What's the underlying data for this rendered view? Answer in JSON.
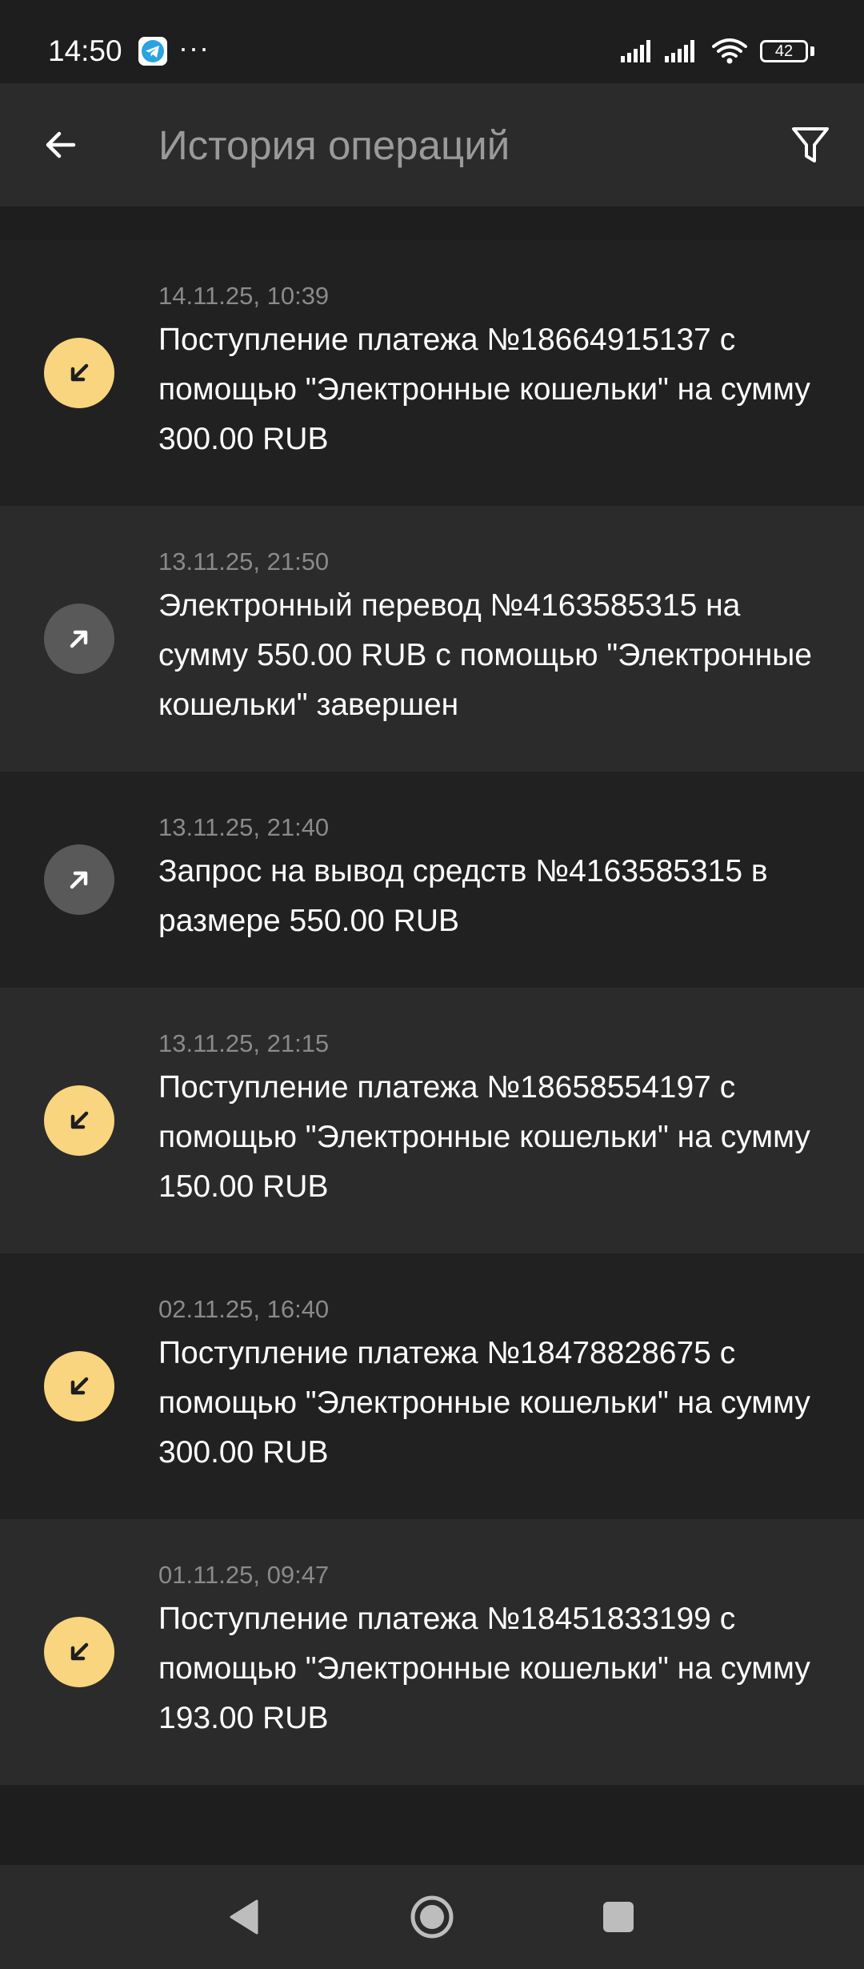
{
  "status_bar": {
    "time": "14:50",
    "dots": "···",
    "battery": "42",
    "icons": [
      "telegram-icon",
      "signal-icon",
      "signal-icon",
      "wifi-icon",
      "battery-icon"
    ]
  },
  "app_bar": {
    "title": "История операций",
    "back_icon": "arrow-left-icon",
    "filter_icon": "filter-icon"
  },
  "transactions": [
    {
      "direction": "in",
      "icon": "arrow-down-left-icon",
      "date": "14.11.25, 10:39",
      "text": "Поступление платежа №18664915137 с помощью \"Электронные кошельки\" на сумму 300.00 RUB"
    },
    {
      "direction": "out",
      "icon": "arrow-up-right-icon",
      "date": "13.11.25, 21:50",
      "text": "Электронный перевод №4163585315 на сумму 550.00 RUB с помощью \"Электронные кошельки\" завершен"
    },
    {
      "direction": "out",
      "icon": "arrow-up-right-icon",
      "date": "13.11.25, 21:40",
      "text": "Запрос на вывод средств №4163585315 в размере 550.00 RUB"
    },
    {
      "direction": "in",
      "icon": "arrow-down-left-icon",
      "date": "13.11.25, 21:15",
      "text": "Поступление платежа №18658554197 с помощью \"Электронные кошельки\" на сумму 150.00 RUB"
    },
    {
      "direction": "in",
      "icon": "arrow-down-left-icon",
      "date": "02.11.25, 16:40",
      "text": "Поступление платежа №18478828675 с помощью \"Электронные кошельки\" на сумму 300.00 RUB"
    },
    {
      "direction": "in",
      "icon": "arrow-down-left-icon",
      "date": "01.11.25, 09:47",
      "text": "Поступление платежа №18451833199 с помощью \"Электронные кошельки\" на сумму 193.00 RUB"
    }
  ],
  "nav_bar": {
    "icons": [
      "nav-back-icon",
      "nav-home-icon",
      "nav-recents-icon"
    ]
  },
  "colors": {
    "background": "#1e1e1e",
    "surface": "#2b2b2b",
    "incoming_icon_bg": "#f8d57e",
    "outgoing_icon_bg": "#595959",
    "date_text": "#8a8a8a",
    "title_text": "#9a9a9a"
  }
}
